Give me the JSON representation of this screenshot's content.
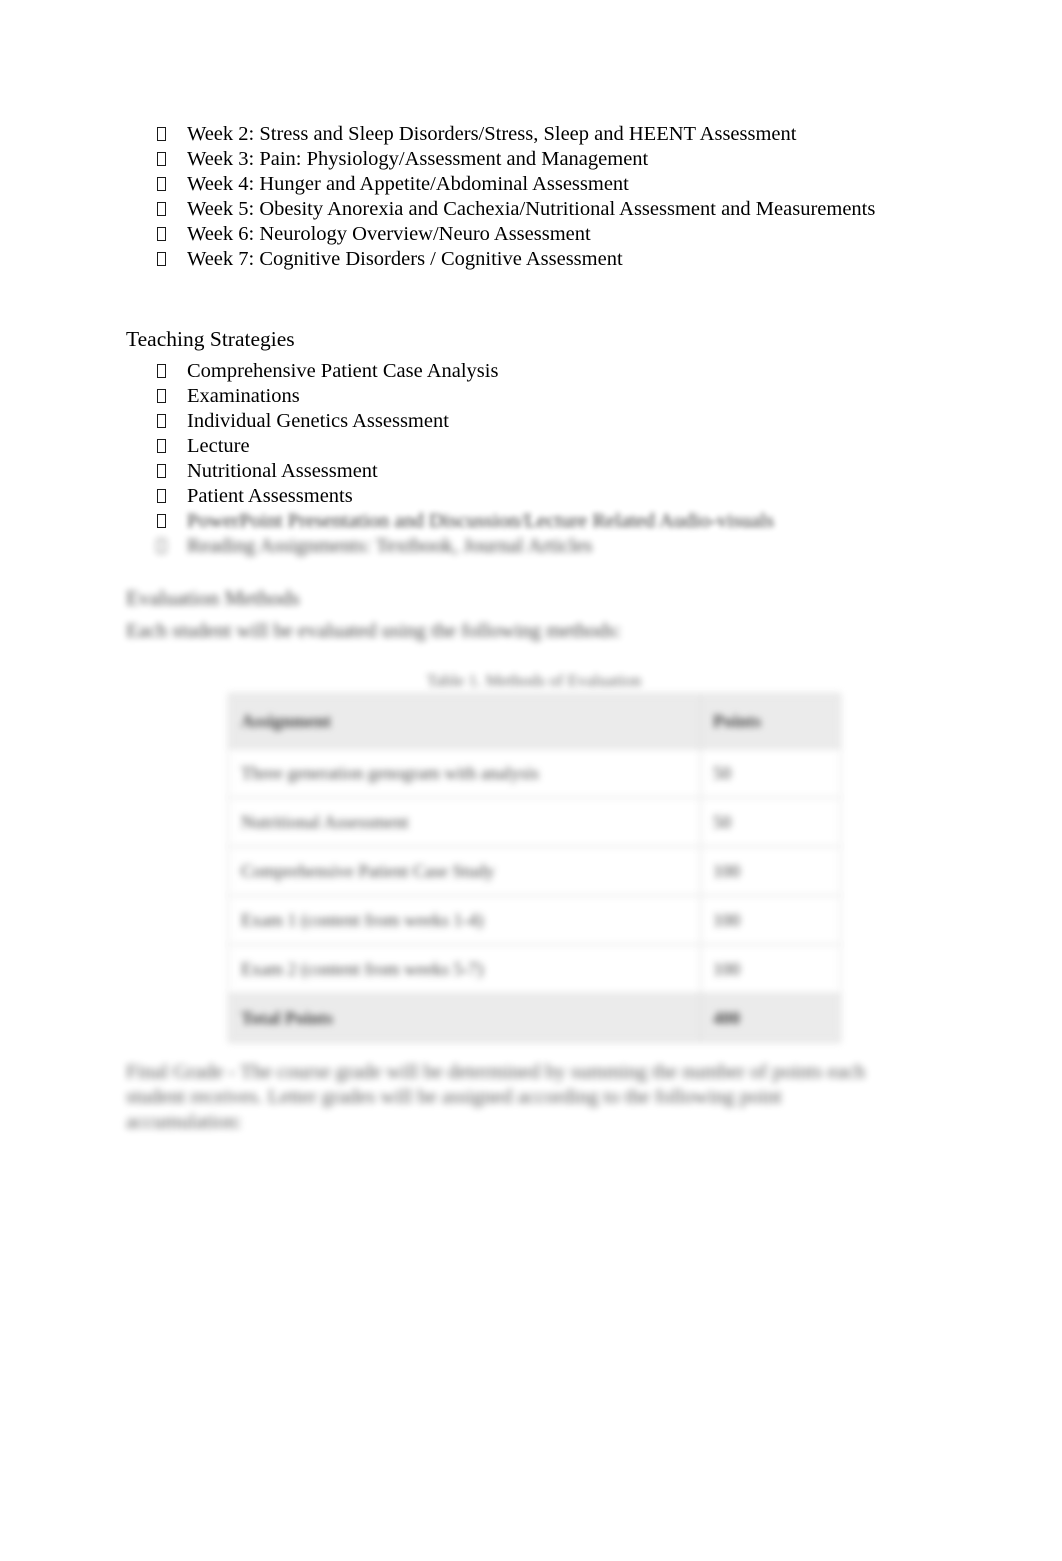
{
  "bullet_glyph": "missing-glyph-box",
  "weeks": {
    "items": [
      "Week 2: Stress and Sleep Disorders/Stress, Sleep and HEENT Assessment",
      "Week 3: Pain: Physiology/Assessment and Management",
      "Week 4: Hunger and Appetite/Abdominal Assessment",
      "Week 5: Obesity Anorexia and Cachexia/Nutritional Assessment and Measurements",
      "Week 6: Neurology Overview/Neuro Assessment",
      "Week 7: Cognitive Disorders / Cognitive Assessment"
    ]
  },
  "teaching": {
    "heading": "Teaching Strategies",
    "items": [
      "Comprehensive Patient Case Analysis",
      "Examinations",
      "Individual Genetics Assessment",
      "Lecture",
      "Nutritional Assessment",
      "Patient Assessments",
      "PowerPoint Presentation and Discussion/Lecture Related Audio-visuals",
      "Reading Assignments: Textbook, Journal Articles"
    ]
  },
  "evaluation": {
    "heading": "Evaluation Methods",
    "intro": "Each student will be evaluated using the following methods:",
    "table": {
      "caption": "Table 1. Methods of Evaluation",
      "columns": [
        "Assignment",
        "Points"
      ],
      "rows": [
        {
          "assignment": "Three generation genogram with analysis",
          "points": "50"
        },
        {
          "assignment": "Nutritional Assessment",
          "points": "50"
        },
        {
          "assignment": "Comprehensive Patient Case Study",
          "points": "100"
        },
        {
          "assignment": "Exam 1 (content from weeks 1-4)",
          "points": "100"
        },
        {
          "assignment": "Exam 2 (content from weeks 5-7)",
          "points": "100"
        }
      ],
      "total_label": "Total Points",
      "total_points": "400"
    }
  },
  "grade_note": "Final Grade - The course grade will be determined by summing the number of points each student receives. Letter grades will be assigned according to the following point accumulation:"
}
